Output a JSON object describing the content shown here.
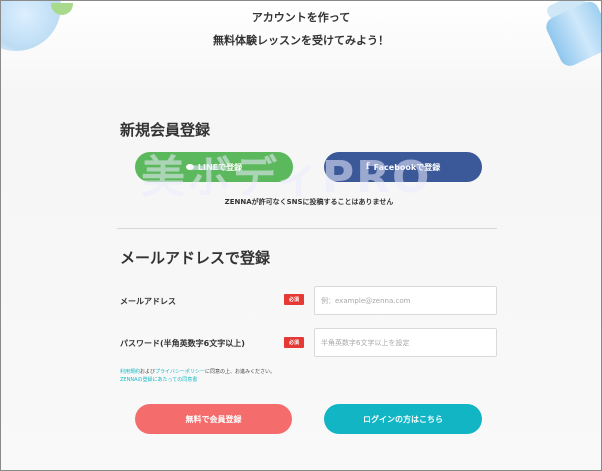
{
  "hero": {
    "line1": "アカウントを作って",
    "line2": "無料体験レッスンを受けてみよう！"
  },
  "sns_section": {
    "title": "新規会員登録",
    "line_button": {
      "label": "LINEで登録",
      "icon": "line-icon",
      "color": "#5cb85c"
    },
    "facebook_button": {
      "label": "Facebookで登録",
      "icon": "f",
      "color": "#3b5998"
    },
    "note": "ZENNAが許可なくSNSに投稿することはありません"
  },
  "watermark": "美ボディPRO",
  "email_section": {
    "title": "メールアドレスで登録",
    "email": {
      "label": "メールアドレス",
      "required": "必須",
      "placeholder": "例：example@zenna.com",
      "value": ""
    },
    "password": {
      "label": "パスワード(半角英数字6文字以上)",
      "required": "必須",
      "placeholder": "半角英数字6文字以上を設定",
      "value": ""
    }
  },
  "terms": {
    "link1": "利用規約",
    "text1": "および",
    "link2": "プライバシーポリシー",
    "text2": "に同意の上、お進みください。",
    "link3": "ZENNAの登録にあたっての同意書"
  },
  "actions": {
    "signup_label": "無料で会員登録",
    "login_label": "ログインの方はこちら"
  },
  "colors": {
    "required_badge": "#e53935",
    "signup": "#f56c6c",
    "login": "#12b5c4",
    "link": "#17b8c4"
  }
}
